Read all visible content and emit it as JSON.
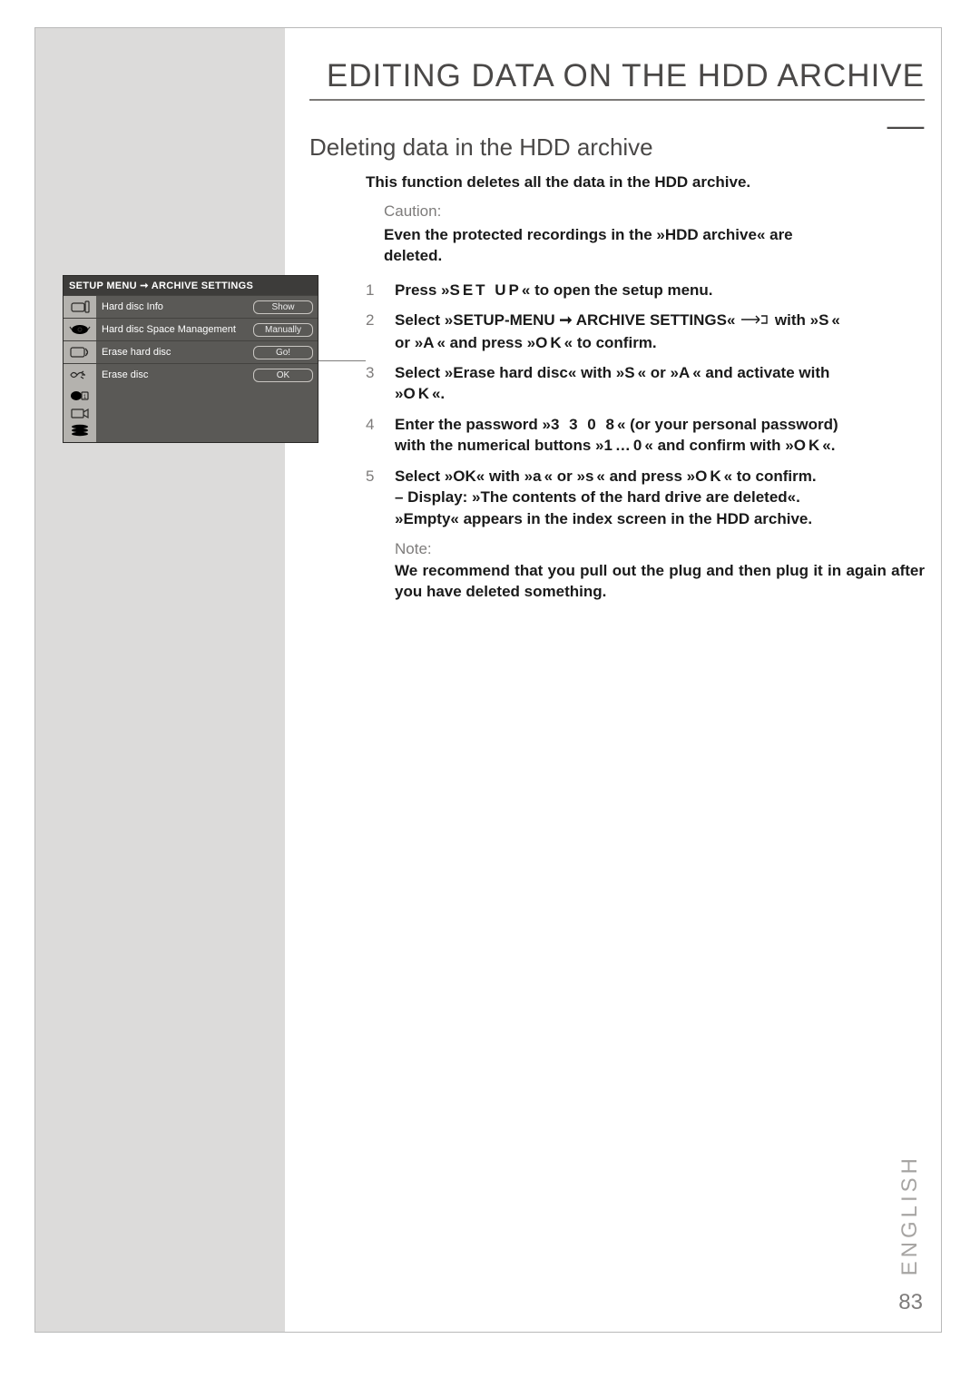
{
  "header": {
    "title": "EDITING DATA ON THE HDD ARCHIVE __"
  },
  "subtitle": "Deleting data in the HDD archive",
  "intro": "This function deletes all the data in the HDD archive.",
  "caution_label": "Caution:",
  "caution_text_a": "Even the protected recordings in the »HDD archive« are",
  "caution_text_b": "deleted.",
  "steps": [
    {
      "n": "1",
      "parts": [
        "Press »",
        "SET UP",
        "« to open the setup menu."
      ]
    },
    {
      "n": "2",
      "parts_line1": [
        "Select »SETUP-MENU ➞ ARCHIVE SETTINGS«",
        "       with »",
        "S",
        "«"
      ],
      "parts_line2": [
        "or »",
        "A",
        "« and press »",
        "OK",
        "« to confirm."
      ]
    },
    {
      "n": "3",
      "parts": [
        "Select »Erase hard disc« with »",
        "S",
        "« or »",
        "A",
        "« and activate with",
        "»",
        "OK",
        "«."
      ]
    },
    {
      "n": "4",
      "parts_line1": [
        "Enter the password »",
        "3 3 0 8",
        "« (or your personal password)"
      ],
      "parts_line2": [
        "with the numerical buttons »",
        "1…0",
        "« and confirm with »",
        "OK",
        "«."
      ]
    },
    {
      "n": "5",
      "parts_line1": [
        "Select »OK« with »",
        "a",
        "« or »",
        "s",
        "« and press »",
        "OK",
        "« to confirm."
      ],
      "parts_line2": [
        "– Display: »The contents of the hard drive are deleted«."
      ],
      "parts_line3": [
        "»Empty« appears in the index screen in the HDD archive."
      ]
    }
  ],
  "note_label": "Note:",
  "note_text": "We recommend that you pull out the plug and then plug it in again after you have deleted something.",
  "menu": {
    "header": "SETUP MENU ➞ ARCHIVE SETTINGS",
    "rows": [
      {
        "icon": "hdd-info-icon",
        "label": "Hard disc Info",
        "value": "Show"
      },
      {
        "icon": "space-icon",
        "label": "Hard disc Space Management",
        "value": "Manually"
      },
      {
        "icon": "erase-hd-icon",
        "label": "Erase hard disc",
        "value": "Go!"
      },
      {
        "icon": "erase-d-icon",
        "label": "Erase disc",
        "value": "OK"
      }
    ],
    "extra_icons": [
      "calendar-icon",
      "camera-icon",
      "disc-stack-icon"
    ]
  },
  "lang": "ENGLISH",
  "page_number": "83"
}
